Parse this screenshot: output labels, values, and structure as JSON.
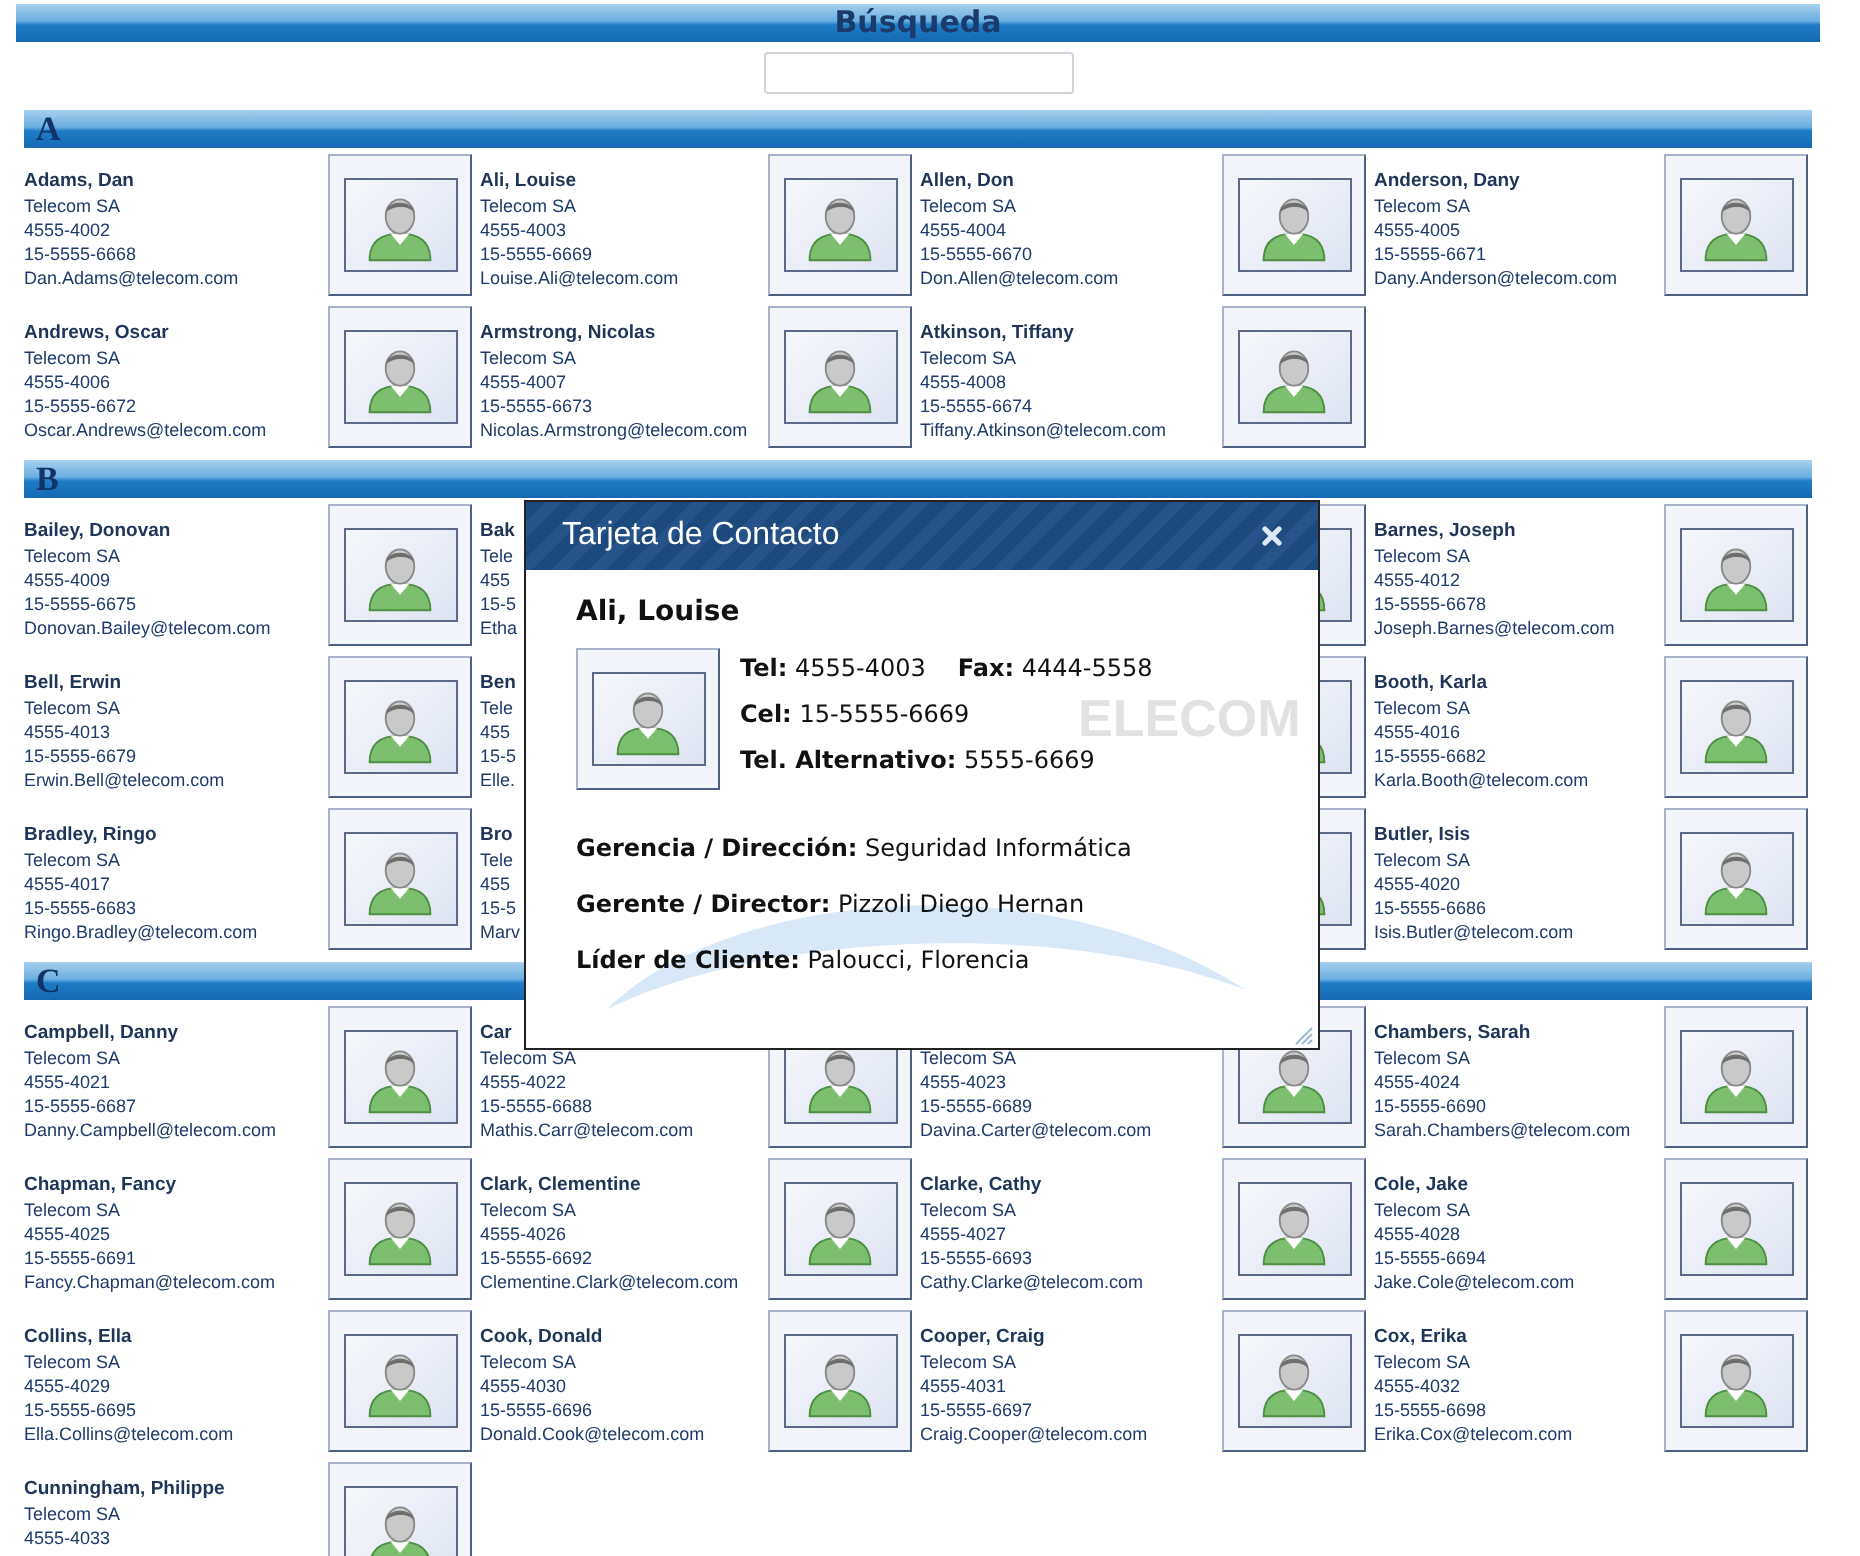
{
  "page": {
    "title": "Búsqueda"
  },
  "sections": [
    {
      "letter": "A",
      "contacts": [
        {
          "name": "Adams, Dan",
          "company": "Telecom SA",
          "phone": "4555-4002",
          "mobile": "15-5555-6668",
          "email": "Dan.Adams@telecom.com",
          "photo": true
        },
        {
          "name": "Ali, Louise",
          "company": "Telecom SA",
          "phone": "4555-4003",
          "mobile": "15-5555-6669",
          "email": "Louise.Ali@telecom.com",
          "photo": true
        },
        {
          "name": "Allen, Don",
          "company": "Telecom SA",
          "phone": "4555-4004",
          "mobile": "15-5555-6670",
          "email": "Don.Allen@telecom.com",
          "photo": true
        },
        {
          "name": "Anderson, Dany",
          "company": "Telecom SA",
          "phone": "4555-4005",
          "mobile": "15-5555-6671",
          "email": "Dany.Anderson@telecom.com",
          "photo": true
        },
        {
          "name": "Andrews, Oscar",
          "company": "Telecom SA",
          "phone": "4555-4006",
          "mobile": "15-5555-6672",
          "email": "Oscar.Andrews@telecom.com",
          "photo": true
        },
        {
          "name": "Armstrong, Nicolas",
          "company": "Telecom SA",
          "phone": "4555-4007",
          "mobile": "15-5555-6673",
          "email": "Nicolas.Armstrong@telecom.com",
          "photo": true
        },
        {
          "name": "Atkinson, Tiffany",
          "company": "Telecom SA",
          "phone": "4555-4008",
          "mobile": "15-5555-6674",
          "email": "Tiffany.Atkinson@telecom.com",
          "photo": true
        }
      ]
    },
    {
      "letter": "B",
      "contacts": [
        {
          "name": "Bailey, Donovan",
          "company": "Telecom SA",
          "phone": "4555-4009",
          "mobile": "15-5555-6675",
          "email": "Donovan.Bailey@telecom.com",
          "photo": true
        },
        {
          "name": "Bak",
          "company": "Tele",
          "phone": "455",
          "mobile": "15-5",
          "email": "Etha",
          "photo": false
        },
        {
          "photo": true
        },
        {
          "name": "Barnes, Joseph",
          "company": "Telecom SA",
          "phone": "4555-4012",
          "mobile": "15-5555-6678",
          "email": "Joseph.Barnes@telecom.com",
          "photo": true
        },
        {
          "name": "Bell, Erwin",
          "company": "Telecom SA",
          "phone": "4555-4013",
          "mobile": "15-5555-6679",
          "email": "Erwin.Bell@telecom.com",
          "photo": true
        },
        {
          "name": "Ben",
          "company": "Tele",
          "phone": "455",
          "mobile": "15-5",
          "email": "Elle.",
          "photo": false
        },
        {
          "photo": true
        },
        {
          "name": "Booth, Karla",
          "company": "Telecom SA",
          "phone": "4555-4016",
          "mobile": "15-5555-6682",
          "email": "Karla.Booth@telecom.com",
          "photo": true
        },
        {
          "name": "Bradley, Ringo",
          "company": "Telecom SA",
          "phone": "4555-4017",
          "mobile": "15-5555-6683",
          "email": "Ringo.Bradley@telecom.com",
          "photo": true
        },
        {
          "name": "Bro",
          "company": "Tele",
          "phone": "455",
          "mobile": "15-5",
          "email": "Marv",
          "photo": false
        },
        {
          "photo": true
        },
        {
          "name": "Butler, Isis",
          "company": "Telecom SA",
          "phone": "4555-4020",
          "mobile": "15-5555-6686",
          "email": "Isis.Butler@telecom.com",
          "photo": true
        }
      ]
    },
    {
      "letter": "C",
      "contacts": [
        {
          "name": "Campbell, Danny",
          "company": "Telecom SA",
          "phone": "4555-4021",
          "mobile": "15-5555-6687",
          "email": "Danny.Campbell@telecom.com",
          "photo": true
        },
        {
          "name": "Car",
          "company": "Telecom SA",
          "phone": "4555-4022",
          "mobile": "15-5555-6688",
          "email": "Mathis.Carr@telecom.com",
          "photo": true
        },
        {
          "company": "Telecom SA",
          "phone": "4555-4023",
          "mobile": "15-5555-6689",
          "email": "Davina.Carter@telecom.com",
          "photo": true
        },
        {
          "name": "Chambers, Sarah",
          "company": "Telecom SA",
          "phone": "4555-4024",
          "mobile": "15-5555-6690",
          "email": "Sarah.Chambers@telecom.com",
          "photo": true
        },
        {
          "name": "Chapman, Fancy",
          "company": "Telecom SA",
          "phone": "4555-4025",
          "mobile": "15-5555-6691",
          "email": "Fancy.Chapman@telecom.com",
          "photo": true
        },
        {
          "name": "Clark, Clementine",
          "company": "Telecom SA",
          "phone": "4555-4026",
          "mobile": "15-5555-6692",
          "email": "Clementine.Clark@telecom.com",
          "photo": true
        },
        {
          "name": "Clarke, Cathy",
          "company": "Telecom SA",
          "phone": "4555-4027",
          "mobile": "15-5555-6693",
          "email": "Cathy.Clarke@telecom.com",
          "photo": true
        },
        {
          "name": "Cole, Jake",
          "company": "Telecom SA",
          "phone": "4555-4028",
          "mobile": "15-5555-6694",
          "email": "Jake.Cole@telecom.com",
          "photo": true
        },
        {
          "name": "Collins, Ella",
          "company": "Telecom SA",
          "phone": "4555-4029",
          "mobile": "15-5555-6695",
          "email": "Ella.Collins@telecom.com",
          "photo": true
        },
        {
          "name": "Cook, Donald",
          "company": "Telecom SA",
          "phone": "4555-4030",
          "mobile": "15-5555-6696",
          "email": "Donald.Cook@telecom.com",
          "photo": true
        },
        {
          "name": "Cooper, Craig",
          "company": "Telecom SA",
          "phone": "4555-4031",
          "mobile": "15-5555-6697",
          "email": "Craig.Cooper@telecom.com",
          "photo": true
        },
        {
          "name": "Cox, Erika",
          "company": "Telecom SA",
          "phone": "4555-4032",
          "mobile": "15-5555-6698",
          "email": "Erika.Cox@telecom.com",
          "photo": true
        },
        {
          "name": "Cunningham, Philippe",
          "company": "Telecom SA",
          "phone": "4555-4033",
          "photo": true
        }
      ]
    }
  ],
  "modal": {
    "title": "Tarjeta de Contacto",
    "name": "Ali, Louise",
    "logo_text": "ELECOM",
    "contact_lines": [
      [
        {
          "label": "Tel:",
          "value": "4555-4003"
        },
        {
          "label": "Fax:",
          "value": "4444-5558"
        }
      ],
      [
        {
          "label": "Cel:",
          "value": "15-5555-6669"
        }
      ],
      [
        {
          "label": "Tel. Alternativo:",
          "value": "5555-6669"
        }
      ]
    ],
    "details": [
      {
        "label": "Gerencia / Dirección:",
        "value": "Seguridad Informática"
      },
      {
        "label": "Gerente / Director:",
        "value": "Pizzoli Diego Hernan"
      },
      {
        "label": "Líder de Cliente:",
        "value": "Paloucci, Florencia"
      }
    ]
  }
}
